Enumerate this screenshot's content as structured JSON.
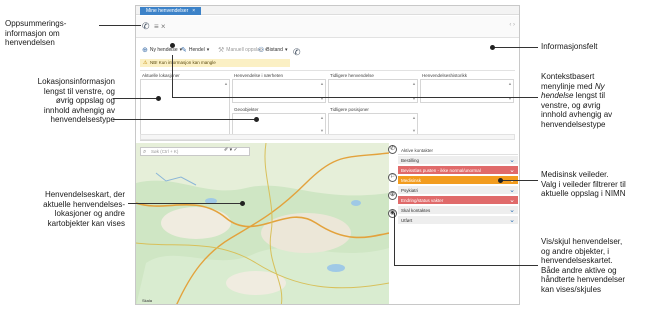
{
  "callouts": {
    "summary": "Oppsummerings-\ninformasjon om\nhenvendelsen",
    "location": "Lokasjonsinformasjon\nlengst til venstre, og\nøvrig oppslag og\ninnhold avhengig av\nhenvendelsestype",
    "map": "Henvendelseskart, der\naktuelle henvendelses-\nlokasjoner og andre\nkartobjekter kan vises",
    "info_field": "Informasjonsfelt",
    "context_menu_pre": "Kontekstbasert\nmenylinje med ",
    "context_menu_em": "Ny\nhendelse",
    "context_menu_post": " lengst til\nvenstre, og øvrig\ninnhold avhengig av\nhenvendelsestype",
    "medical": "Medisinsk veileder.\nValg i veileder filtrerer til\naktuelle oppslag i NIMN",
    "toggle": "Vis/skjul henvendelser,\nog andre objekter, i\nhenvendelseskartet.\nBåde andre aktive og\nhåndterte henvendelser\nkan vises/skjules"
  },
  "app": {
    "tab_label": "Mine henvendelser",
    "tab_close": "×",
    "toolbar": {
      "new_event": "Ny hendelse",
      "new_event_caret": "▾",
      "update": "Hendel",
      "update_caret": "▾",
      "manual": "Manuell oppslag",
      "manual_caret": "▾",
      "assist": "Bistand",
      "assist_caret": "▾"
    },
    "warning": "NB! Kun informasjon kan mangle",
    "field_headers": [
      "Aktuelle lokasjoner",
      "Henvendelse i nærheten",
      "Tidligere henvendelse",
      "Henvendelseshistorikk"
    ],
    "field_headers_2": [
      "Geoobjekter",
      "Tidligere posisjoner"
    ],
    "map_search_placeholder": "Søk (Ctrl + K)",
    "map_scale": "Skala"
  },
  "guide": {
    "header": "Aktive kontakter",
    "rows": [
      {
        "label": "Bestilling",
        "status": "normal"
      },
      {
        "label": "Bevisstløs pusten - ikke normal/unormal",
        "status": "red"
      },
      {
        "label": "Medisinsk",
        "status": "orange"
      },
      {
        "label": "Psykiatri",
        "status": "normal"
      },
      {
        "label": "Endring/status vakter",
        "status": "red"
      },
      {
        "label": "Skal kontaktes",
        "status": "normal"
      },
      {
        "label": "Utført",
        "status": "normal"
      }
    ]
  },
  "colors": {
    "tab": "#3c82c8",
    "red": "#e06a6a",
    "orange": "#f29c1f",
    "chevron": "#2a6fb5"
  }
}
